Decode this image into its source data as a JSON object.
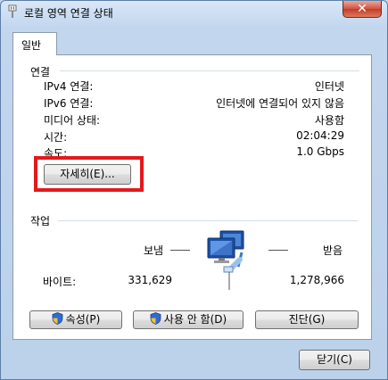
{
  "window": {
    "title": "로컬 영역 연결 상태",
    "close_symbol": "✕",
    "icon": "network-adapter-icon"
  },
  "tabs": [
    {
      "label": "일반",
      "selected": true
    }
  ],
  "connection": {
    "heading": "연결",
    "rows": [
      {
        "label": "IPv4 연결:",
        "value": "인터넷"
      },
      {
        "label": "IPv6 연결:",
        "value": "인터넷에 연결되어 있지 않음"
      },
      {
        "label": "미디어 상태:",
        "value": "사용함"
      },
      {
        "label": "시간:",
        "value": "02:04:29"
      },
      {
        "label": "속도:",
        "value": "1.0 Gbps"
      }
    ],
    "details_button": "자세히(E)..."
  },
  "activity": {
    "heading": "작업",
    "sent_label": "보냄",
    "received_label": "받음",
    "bytes_label": "바이트:",
    "bytes_sent": "331,629",
    "bytes_received": "1,278,966",
    "icon": "network-activity-icon"
  },
  "actions": {
    "properties": "속성(P)",
    "disable": "사용 안 함(D)",
    "diagnose": "진단(G)",
    "close": "닫기(C)"
  },
  "highlight_color": "#e3191b"
}
